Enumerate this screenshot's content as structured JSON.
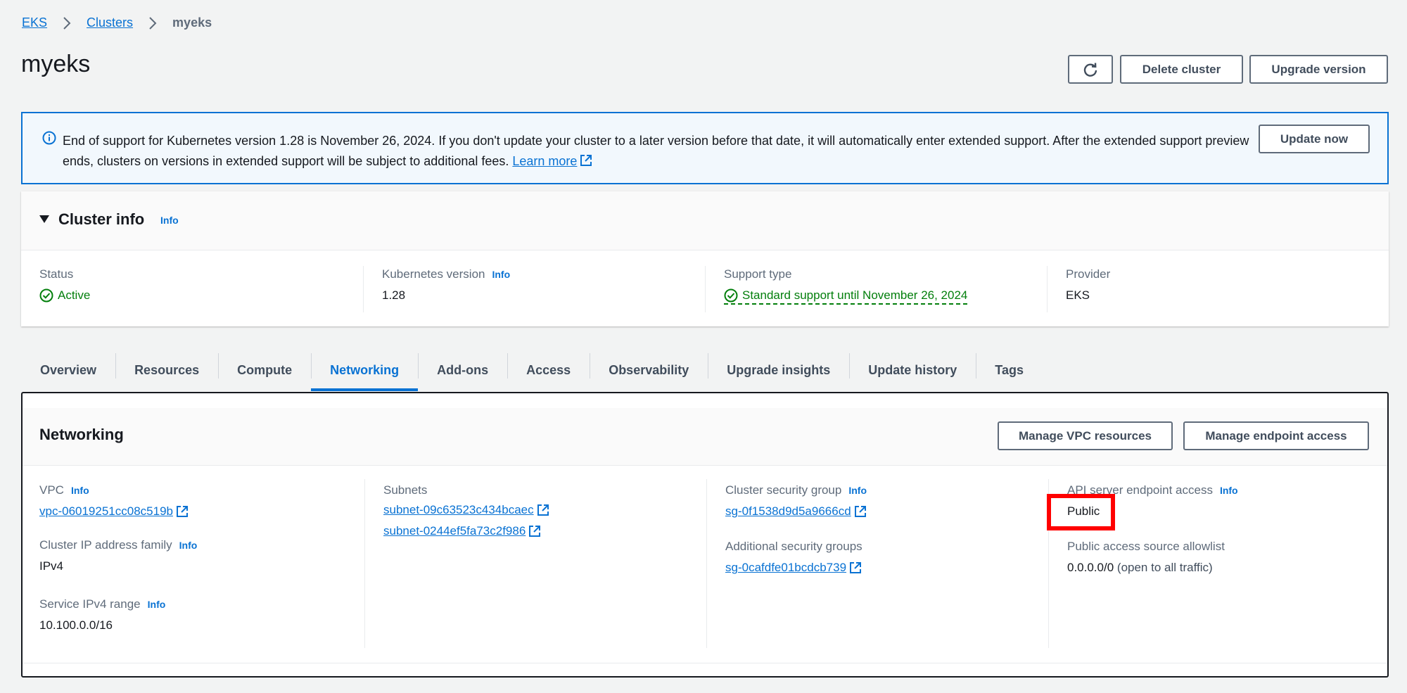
{
  "breadcrumb": {
    "items": [
      "EKS",
      "Clusters"
    ],
    "current": "myeks"
  },
  "page": {
    "title": "myeks",
    "delete_label": "Delete cluster",
    "upgrade_label": "Upgrade version"
  },
  "alert": {
    "text": "End of support for Kubernetes version 1.28 is November 26, 2024. If you don't update your cluster to a later version before that date, it will automatically enter extended support. After the extended support preview ends, clusters on versions in extended support will be subject to additional fees.",
    "learn_more": "Learn more",
    "button": "Update now"
  },
  "cluster_info": {
    "title": "Cluster info",
    "info": "Info",
    "status_label": "Status",
    "status_value": "Active",
    "k8s_label": "Kubernetes version",
    "k8s_value": "1.28",
    "support_label": "Support type",
    "support_value": "Standard support until November 26, 2024",
    "provider_label": "Provider",
    "provider_value": "EKS"
  },
  "tabs": [
    {
      "label": "Overview"
    },
    {
      "label": "Resources"
    },
    {
      "label": "Compute"
    },
    {
      "label": "Networking"
    },
    {
      "label": "Add-ons"
    },
    {
      "label": "Access"
    },
    {
      "label": "Observability"
    },
    {
      "label": "Upgrade insights"
    },
    {
      "label": "Update history"
    },
    {
      "label": "Tags"
    }
  ],
  "networking": {
    "title": "Networking",
    "manage_vpc": "Manage VPC resources",
    "manage_endpoint": "Manage endpoint access",
    "info": "Info",
    "vpc_label": "VPC",
    "vpc_value": "vpc-06019251cc08c519b",
    "ip_family_label": "Cluster IP address family",
    "ip_family_value": "IPv4",
    "service_range_label": "Service IPv4 range",
    "service_range_value": "10.100.0.0/16",
    "subnets_label": "Subnets",
    "subnets": [
      "subnet-09c63523c434bcaec",
      "subnet-0244ef5fa73c2f986"
    ],
    "csg_label": "Cluster security group",
    "csg_value": "sg-0f1538d9d5a9666cd",
    "asg_label": "Additional security groups",
    "asg_value": "sg-0cafdfe01bcdcb739",
    "api_label": "API server endpoint access",
    "api_value": "Public",
    "allowlist_label": "Public access source allowlist",
    "allowlist_value": "0.0.0.0/0",
    "allowlist_note": "(open to all traffic)"
  },
  "colors": {
    "link": "#0972d3",
    "success": "#037f0c",
    "highlight": "#ff0000"
  }
}
